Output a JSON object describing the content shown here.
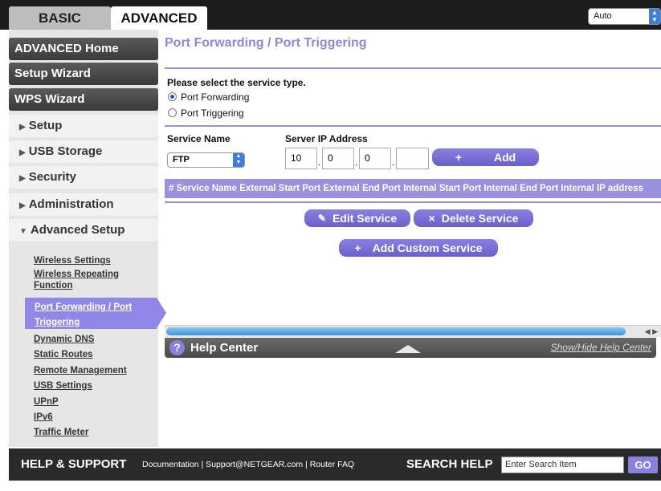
{
  "tabs": {
    "basic": "BASIC",
    "advanced": "ADVANCED"
  },
  "language": {
    "selected": "Auto"
  },
  "sidebar": {
    "main_items": [
      "ADVANCED Home",
      "Setup Wizard",
      "WPS Wizard"
    ],
    "sections": [
      "Setup",
      "USB Storage",
      "Security",
      "Administration",
      "Advanced Setup"
    ],
    "sub_items": [
      "Wireless Settings",
      "Wireless Repeating",
      "Function",
      "Port Forwarding / Port",
      "Triggering",
      "Dynamic DNS",
      "Static Routes",
      "Remote Management",
      "USB Settings",
      "UPnP",
      "IPv6",
      "Traffic Meter"
    ]
  },
  "main": {
    "title": "Port Forwarding / Port Triggering",
    "service_type_prompt": "Please select the service type.",
    "radio_port_forwarding": "Port Forwarding",
    "radio_port_triggering": "Port Triggering",
    "service_name_label": "Service Name",
    "server_ip_label": "Server IP Address",
    "service_selected": "FTP",
    "ip": [
      "10",
      "0",
      "0",
      ""
    ],
    "add_button": "Add",
    "table_header": "# Service Name External Start Port External End Port Internal Start Port Internal End Port Internal IP address",
    "edit_button": "Edit Service",
    "delete_button": "Delete Service",
    "add_custom_button": "Add Custom Service"
  },
  "help_center": {
    "title": "Help Center",
    "toggle": "Show/Hide Help Center"
  },
  "footer": {
    "help_support": "HELP & SUPPORT",
    "links": "Documentation | Support@NETGEAR.com | Router FAQ",
    "search_help": "SEARCH HELP",
    "search_placeholder": "Enter Search Item",
    "go": "GO"
  }
}
